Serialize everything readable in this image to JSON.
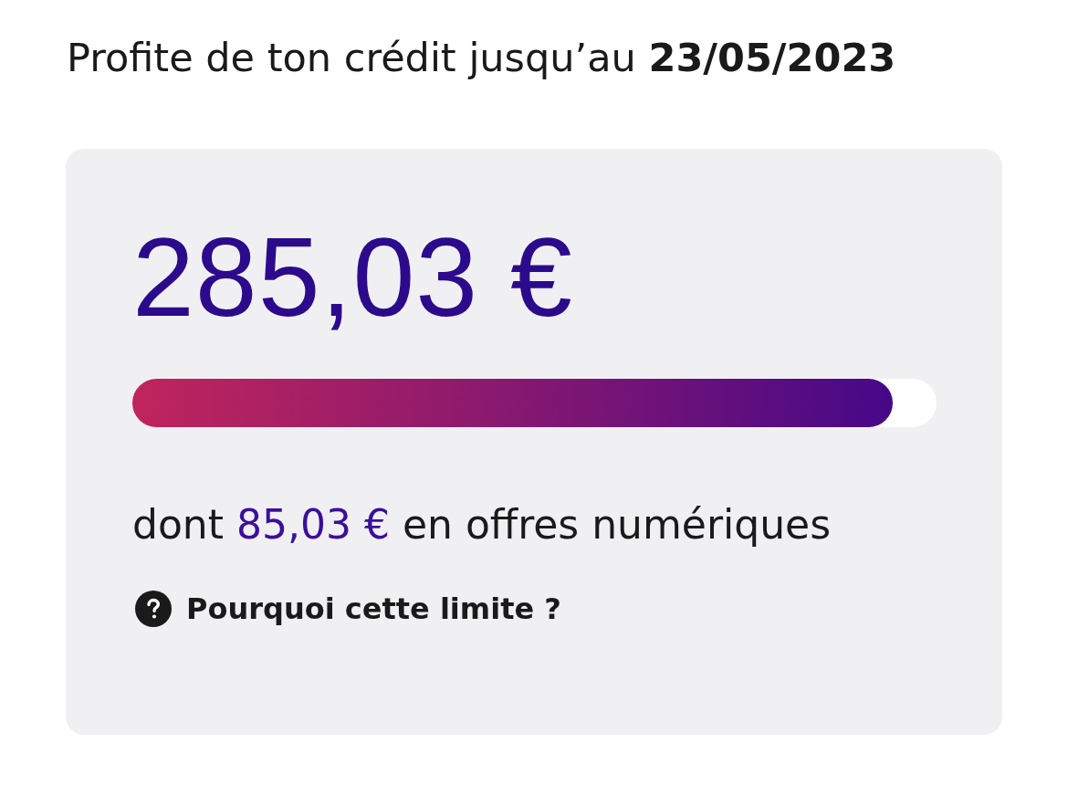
{
  "header": {
    "text": "Profite de ton crédit jusqu’au **23/05/2023**"
  },
  "credit": {
    "amount": "285,03 €",
    "progress": {
      "level": 0.95
    },
    "detail": {
      "before": "dont",
      "amount": "85,03 €",
      "after": "en offres numériques"
    },
    "help_link": {
      "label": "Pourquoi cette limite ?"
    }
  }
}
